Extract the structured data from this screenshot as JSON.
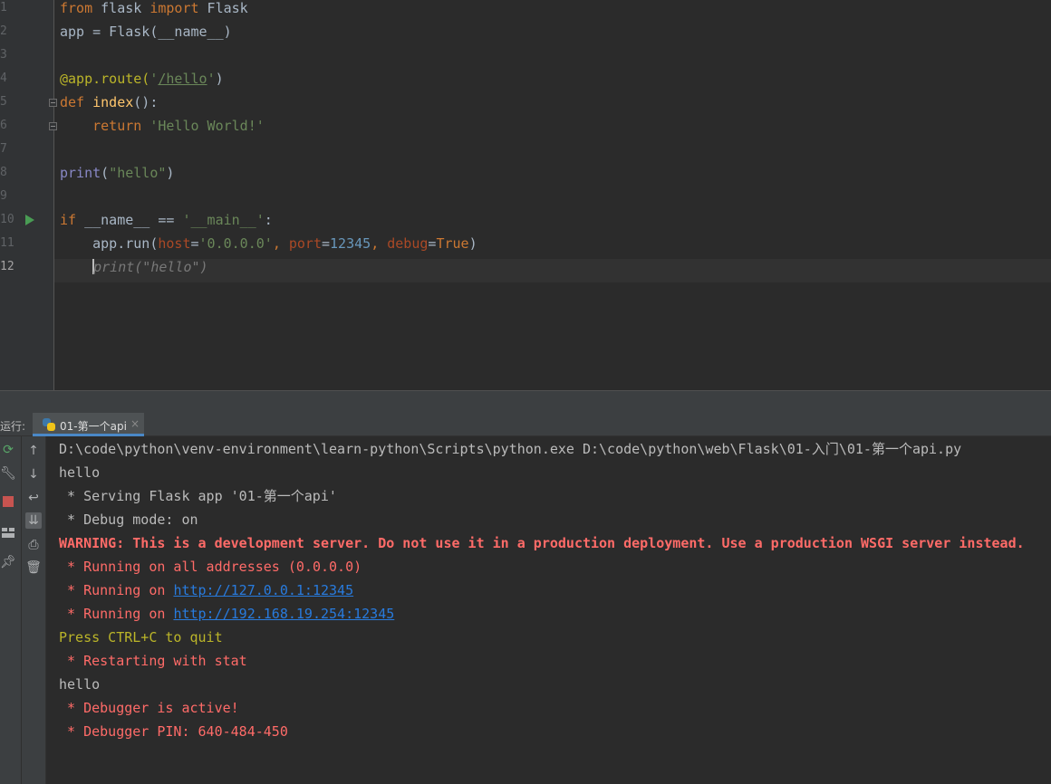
{
  "editor": {
    "line_numbers": [
      "1",
      "2",
      "3",
      "4",
      "5",
      "6",
      "7",
      "8",
      "9",
      "10",
      "11",
      "12"
    ],
    "lines": {
      "l1": {
        "from": "from",
        "mod": " flask ",
        "imp": "import",
        "rest": " Flask"
      },
      "l2": {
        "text": "app = Flask(__name__)"
      },
      "l4": {
        "dec": "@app.route(",
        "str_q1": "'",
        "str_path": "/hello",
        "str_q2": "'",
        "close": ")"
      },
      "l5": {
        "kw": "def",
        "sp": " ",
        "fn": "index",
        "rest": "():"
      },
      "l6": {
        "indent": "    ",
        "kw": "return",
        "sp": " ",
        "str": "'Hello World!'"
      },
      "l8": {
        "builtin": "print",
        "open": "(",
        "str": "\"hello\"",
        "close": ")"
      },
      "l10": {
        "kw": "if",
        "name": " __name__ == ",
        "str": "'__main__'",
        "colon": ":"
      },
      "l11": {
        "indent": "    ",
        "call": "app.run(",
        "p1": "host",
        "eq1": "=",
        "v1": "'0.0.0.0'",
        "c1": ", ",
        "p2": "port",
        "eq2": "=",
        "v2": "12345",
        "c2": ", ",
        "p3": "debug",
        "eq3": "=",
        "v3": "True",
        "close": ")"
      },
      "l12": {
        "indent": "    ",
        "hint": "print(\"hello\")"
      }
    }
  },
  "run_panel": {
    "label": "运行:",
    "tab_label": "01-第一个api",
    "tab_close": "×"
  },
  "console": {
    "cmd": "D:\\code\\python\\venv-environment\\learn-python\\Scripts\\python.exe D:\\code\\python\\web\\Flask\\01-入门\\01-第一个api.py",
    "out1": "hello",
    "serving": " * Serving Flask app '01-第一个api'",
    "debug_mode": " * Debug mode: on",
    "warning": "WARNING: This is a development server. Do not use it in a production deployment. Use a production WSGI server instead.",
    "running_all": " * Running on all addresses (0.0.0.0)",
    "running_prefix": " * Running on ",
    "url1": "http://127.0.0.1:12345",
    "url2": "http://192.168.19.254:12345",
    "quit": "Press CTRL+C to quit",
    "restarting": " * Restarting with stat",
    "out2": "hello",
    "debugger_active": " * Debugger is active!",
    "debugger_pin": " * Debugger PIN: 640-484-450"
  },
  "colors": {
    "background": "#2b2b2b",
    "keyword": "#cc7832",
    "string": "#6a8759",
    "error_red": "#ff6b68",
    "link_blue": "#287bde",
    "run_green": "#499c54"
  },
  "icons": {
    "rerun": "rerun-icon",
    "settings": "wrench-icon",
    "stop": "stop-icon",
    "layout": "layout-icon",
    "pin": "pin-icon",
    "up": "arrow-up-icon",
    "down": "arrow-down-icon",
    "wrap": "soft-wrap-icon",
    "scroll": "scroll-to-end-icon",
    "print": "print-icon",
    "trash": "trash-icon"
  }
}
